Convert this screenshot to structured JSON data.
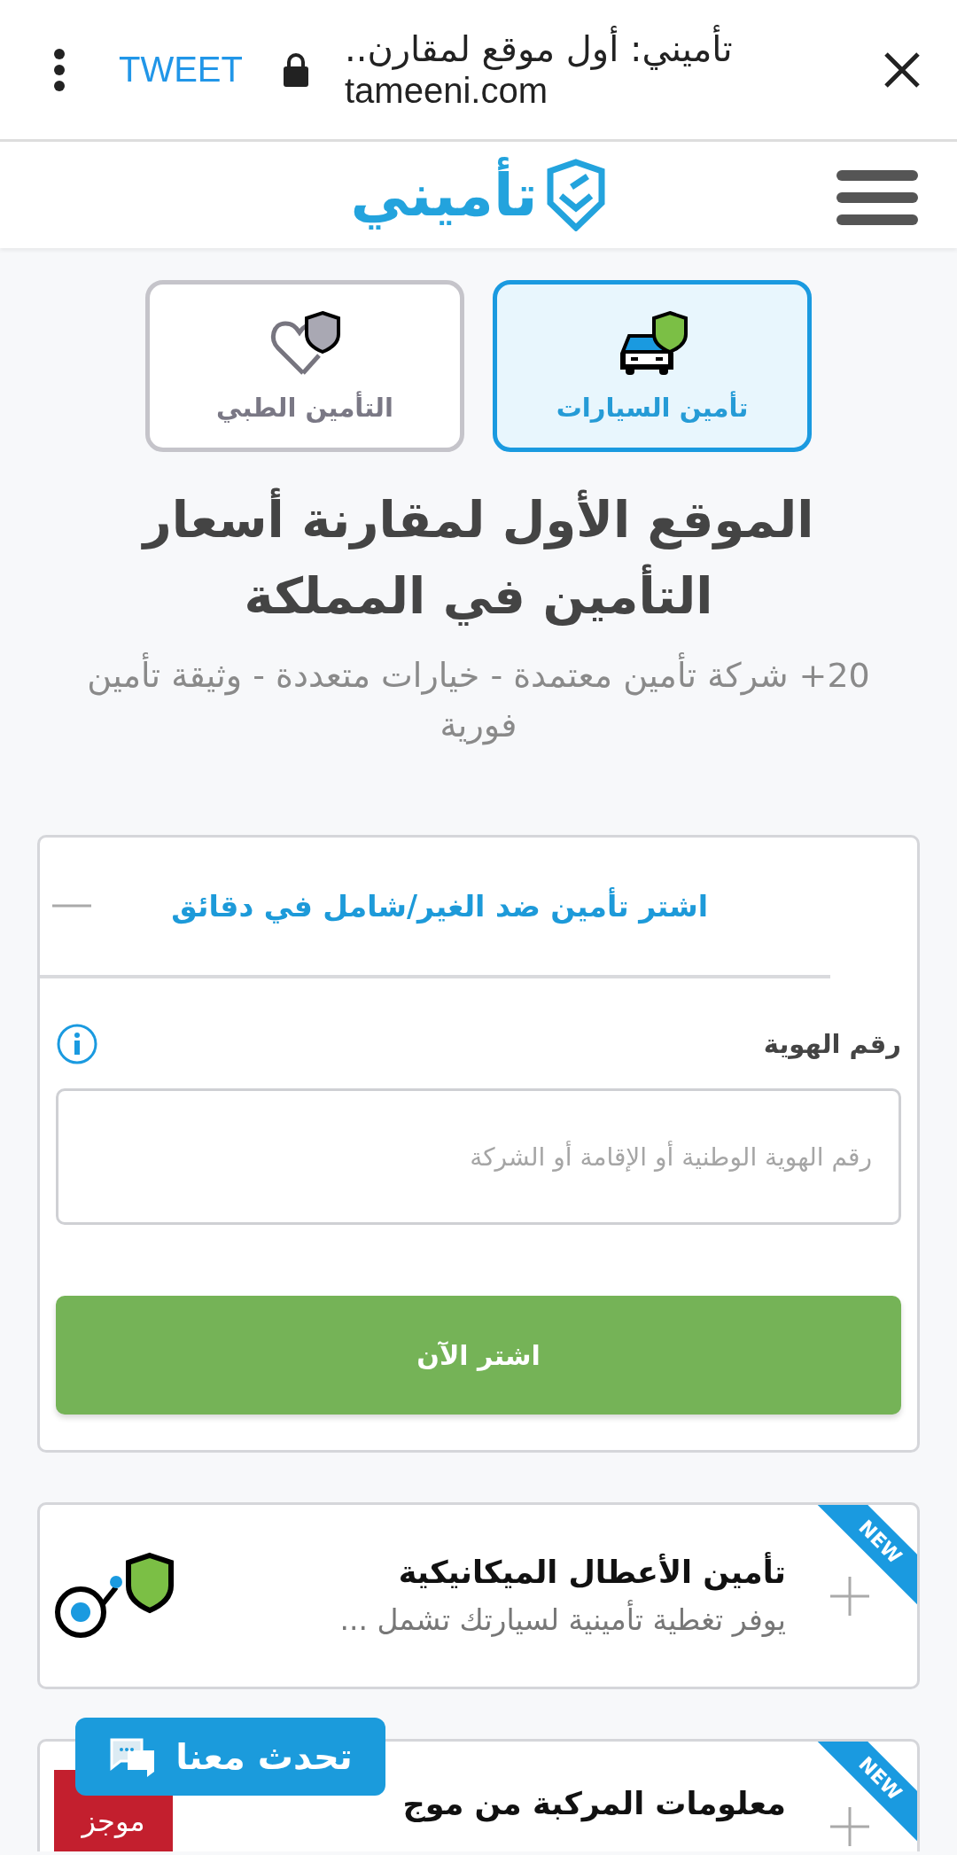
{
  "browser_bar": {
    "title": "تأميني: أول موقع لمقارن..",
    "url": "tameeni.com",
    "share": "TWEET"
  },
  "header": {
    "logo": "تأميني"
  },
  "tabs": [
    {
      "label": "تأمين السيارات",
      "kind": "car",
      "selected": true
    },
    {
      "label": "التأمين الطبي",
      "kind": "medical",
      "selected": false
    }
  ],
  "hero": {
    "title": "الموقع الأول لمقارنة أسعار التأمين في المملكة",
    "subtitle": "20+ شركة تأمين معتمدة - خيارات متعددة - وثيقة تأمين فورية"
  },
  "quote_card": {
    "header": "اشتر تأمين ضد الغير/شامل في دقائق",
    "expanded": true,
    "field_label": "رقم الهوية",
    "placeholder": "رقم الهوية الوطنية أو الإقامة أو الشركة",
    "button": "اشتر الآن"
  },
  "products": [
    {
      "kind": "mechanical",
      "title": "تأمين الأعطال الميكانيكية",
      "description": "يوفر تغطية تأمينية لسيارتك تشمل ...",
      "badge": "NEW",
      "expanded": false
    },
    {
      "kind": "mojaz",
      "title": "معلومات المركبة من موج",
      "logo": "موجز",
      "badge": "NEW",
      "expanded": false
    }
  ],
  "chat_button": {
    "label": "تحدث معنا"
  }
}
